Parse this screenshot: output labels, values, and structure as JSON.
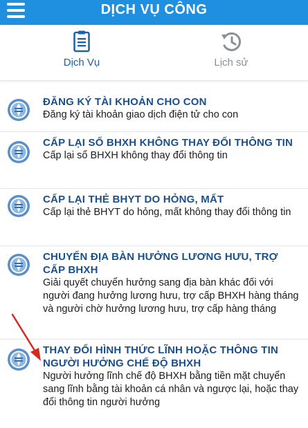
{
  "header": {
    "title": "DỊCH VỤ CÔNG"
  },
  "tabs": [
    {
      "label": "Dịch Vụ",
      "icon": "clipboard-icon",
      "active": true
    },
    {
      "label": "Lịch sử",
      "icon": "history-icon",
      "active": false
    }
  ],
  "services": [
    {
      "title": "ĐĂNG KÝ TÀI KHOẢN CHO CON",
      "description": "Đăng ký tài khoản giao dịch điện tử cho con"
    },
    {
      "title": "CẤP LẠI SỔ BHXH KHÔNG THAY ĐỔI THÔNG TIN",
      "description": "Cấp lại sổ BHXH không thay đổi thông tin"
    },
    {
      "title": "CẤP LẠI THẺ BHYT DO HỎNG, MẤT",
      "description": "Cấp lại thẻ BHYT do hỏng, mất không thay đổi thông tin"
    },
    {
      "title": "CHUYỂN ĐỊA BÀN HƯỞNG LƯƠNG HƯU, TRỢ CẤP BHXH",
      "description": "Giải quyết chuyển hưởng sang địa bàn khác đối với người đang hưởng lương hưu, trợ cấp BHXH hàng tháng và người chờ hưởng lương hưu, trợ cấp hàng tháng"
    },
    {
      "title": "THAY ĐỔI HÌNH THỨC LĨNH HOẶC THÔNG TIN NGƯỜI HƯỞNG CHẾ ĐỘ BHXH",
      "description": "Người hưởng lĩnh chế độ BHXH bằng tiền mặt chuyển sang lĩnh bằng tài khoản cá nhân và ngược lại, hoặc thay đổi thông tin người hưởng"
    }
  ],
  "colors": {
    "header": "#1f8fe0",
    "title_text": "#1b4f8a",
    "arrow": "#d42a22"
  }
}
